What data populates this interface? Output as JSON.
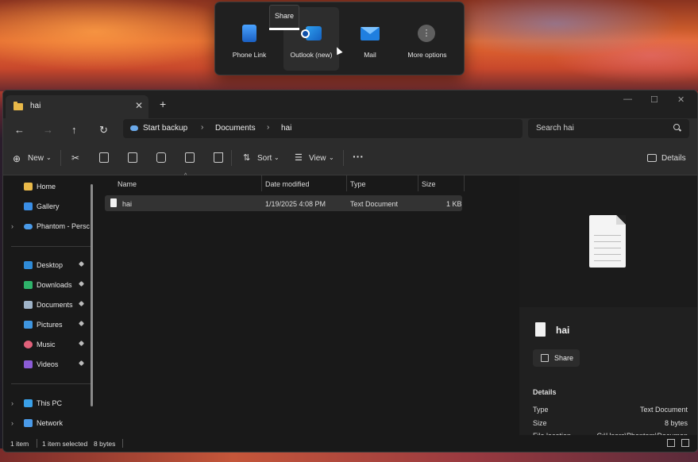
{
  "share_flyout": {
    "tooltip": "Share",
    "apps": [
      {
        "label": "Phone Link",
        "icon": "phone-link-icon"
      },
      {
        "label": "Outlook (new)",
        "icon": "outlook-icon"
      },
      {
        "label": "Mail",
        "icon": "mail-icon"
      },
      {
        "label": "More options",
        "icon": "more-options-icon"
      }
    ]
  },
  "window": {
    "tab_title": "hai",
    "breadcrumb": [
      "Start backup",
      "Documents",
      "hai"
    ],
    "search_placeholder": "Search hai"
  },
  "toolbar": {
    "new_label": "New",
    "sort_label": "Sort",
    "view_label": "View",
    "details_label": "Details"
  },
  "sidebar": {
    "items": [
      {
        "label": "Home",
        "icon": "home-icon"
      },
      {
        "label": "Gallery",
        "icon": "gallery-icon"
      },
      {
        "label": "Phantom - Persc",
        "icon": "onedrive-icon"
      },
      {
        "label": "Desktop",
        "icon": "desktop-icon"
      },
      {
        "label": "Downloads",
        "icon": "downloads-icon"
      },
      {
        "label": "Documents",
        "icon": "documents-icon"
      },
      {
        "label": "Pictures",
        "icon": "pictures-icon"
      },
      {
        "label": "Music",
        "icon": "music-icon"
      },
      {
        "label": "Videos",
        "icon": "videos-icon"
      },
      {
        "label": "This PC",
        "icon": "this-pc-icon"
      },
      {
        "label": "Network",
        "icon": "network-icon"
      }
    ]
  },
  "file_list": {
    "columns": [
      "Name",
      "Date modified",
      "Type",
      "Size"
    ],
    "rows": [
      {
        "name": "hai",
        "date": "1/19/2025 4:08 PM",
        "type": "Text Document",
        "size": "1 KB"
      }
    ]
  },
  "details_pane": {
    "file_name": "hai",
    "share_label": "Share",
    "section_title": "Details",
    "props": [
      {
        "label": "Type",
        "value": "Text Document"
      },
      {
        "label": "Size",
        "value": "8 bytes"
      },
      {
        "label": "File location",
        "value": "C:\\Users\\Phantom\\Documen"
      }
    ]
  },
  "status_bar": {
    "item_count": "1 item",
    "selection": "1 item selected",
    "selection_size": "8 bytes"
  },
  "colors": {
    "folder": "#e9b949",
    "accent_blue": "#2b88d8",
    "window_bg": "#191919",
    "toolbar_bg": "#2c2c2c"
  }
}
